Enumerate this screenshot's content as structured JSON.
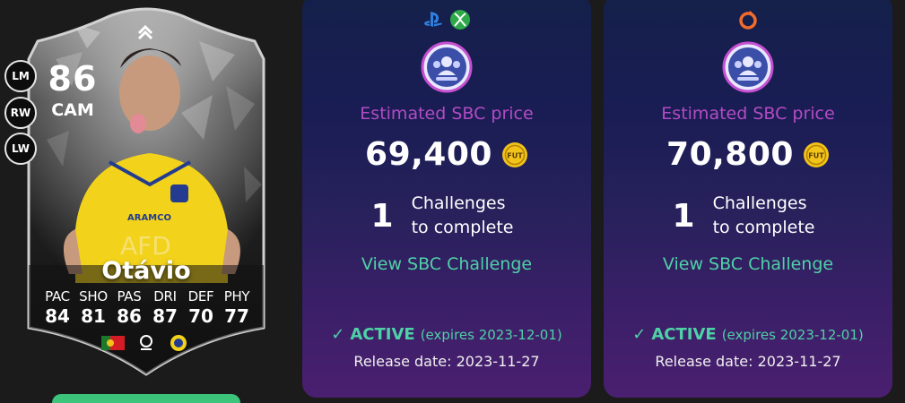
{
  "player": {
    "rating": "86",
    "position": "CAM",
    "alt_positions": [
      "LM",
      "RW",
      "LW"
    ],
    "name": "Otávio",
    "stats": [
      {
        "label": "PAC",
        "value": "84"
      },
      {
        "label": "SHO",
        "value": "81"
      },
      {
        "label": "PAS",
        "value": "86"
      },
      {
        "label": "DRI",
        "value": "87"
      },
      {
        "label": "DEF",
        "value": "70"
      },
      {
        "label": "PHY",
        "value": "77"
      }
    ],
    "kit_text": "AFD",
    "kit_sponsor": "ARAMCO"
  },
  "sbc_panels": [
    {
      "platforms": [
        "playstation-icon",
        "xbox-icon"
      ],
      "price_label": "Estimated SBC price",
      "price": "69,400",
      "coin_text": "FUT",
      "challenge_count": "1",
      "challenge_line1": "Challenges",
      "challenge_line2": "to complete",
      "view_link": "View SBC Challenge",
      "check": "✓",
      "status": "ACTIVE",
      "expiry": "(expires 2023-12-01)",
      "release": "Release date: 2023-11-27"
    },
    {
      "platforms": [
        "origin-pc-icon"
      ],
      "price_label": "Estimated SBC price",
      "price": "70,800",
      "coin_text": "FUT",
      "challenge_count": "1",
      "challenge_line1": "Challenges",
      "challenge_line2": "to complete",
      "view_link": "View SBC Challenge",
      "check": "✓",
      "status": "ACTIVE",
      "expiry": "(expires 2023-12-01)",
      "release": "Release date: 2023-11-27"
    }
  ],
  "colors": {
    "price_label": "#b34bc4",
    "accent_green": "#4fd1a6",
    "coin": "#f2c31b",
    "cta": "#3cc47a"
  }
}
